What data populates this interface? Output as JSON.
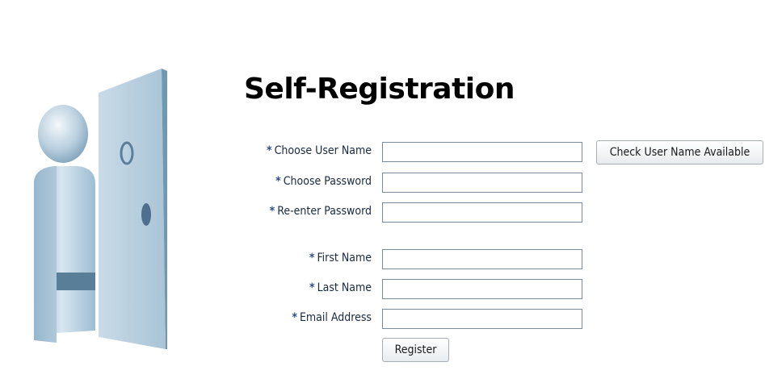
{
  "page": {
    "title": "Self-Registration"
  },
  "form": {
    "required_marker": "*",
    "fields": [
      {
        "label": "Choose User Name",
        "value": ""
      },
      {
        "label": "Choose Password",
        "value": ""
      },
      {
        "label": "Re-enter Password",
        "value": ""
      },
      {
        "label": "First Name",
        "value": ""
      },
      {
        "label": "Last Name",
        "value": ""
      },
      {
        "label": "Email Address",
        "value": ""
      }
    ]
  },
  "buttons": {
    "check_username": "Check User Name Available",
    "register": "Register"
  },
  "colors": {
    "required_marker": "#2e4e8a",
    "input_border": "#7a8a9a",
    "illustration_blue": "#a9c4d6"
  },
  "icons": {
    "illustration": "person-at-door-illustration"
  }
}
